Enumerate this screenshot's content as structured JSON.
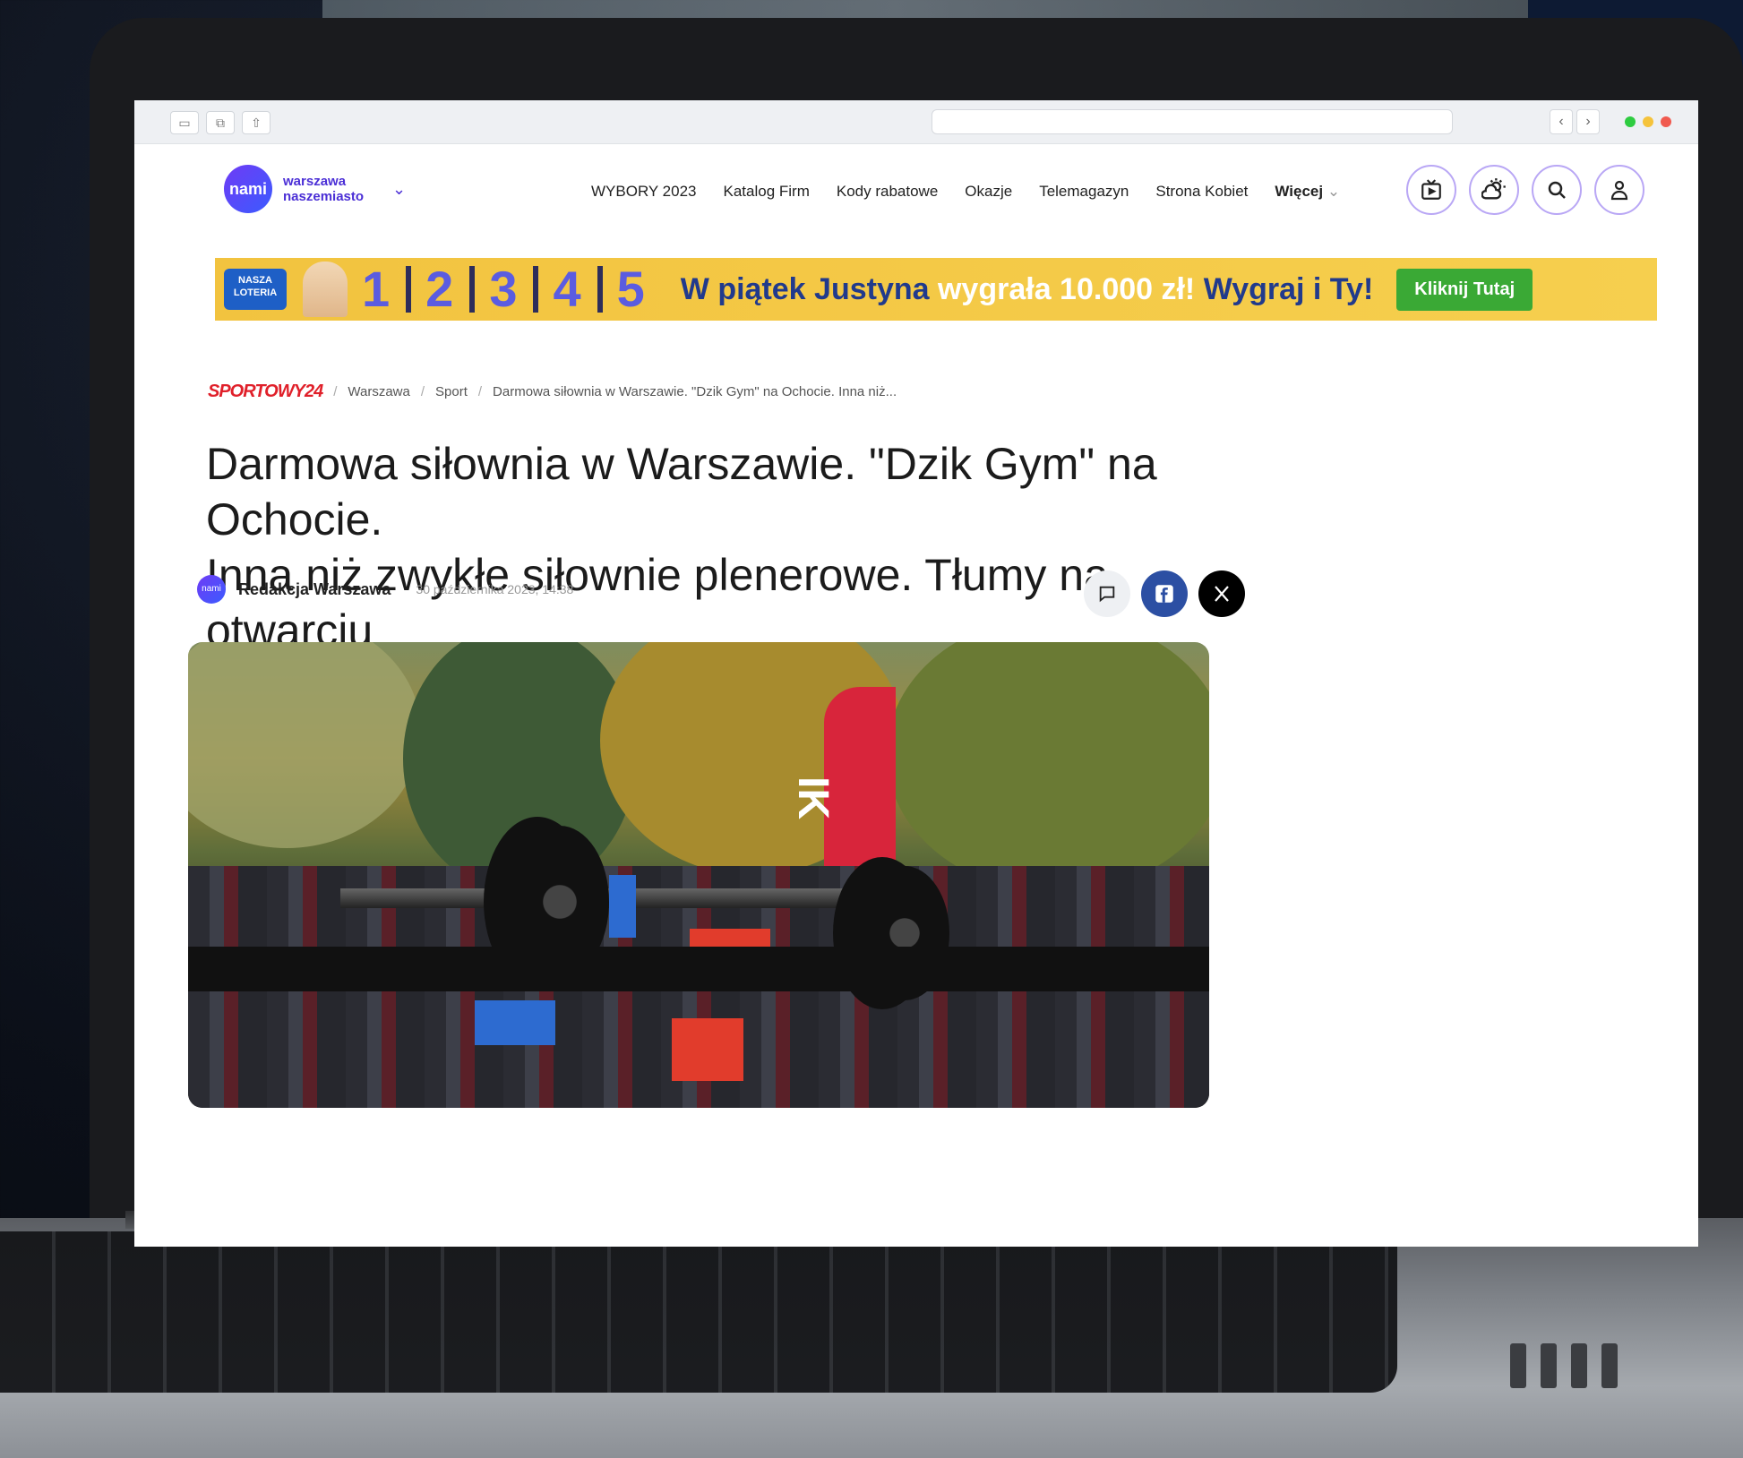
{
  "site": {
    "logo_short": "nami",
    "logo_line1": "warszawa",
    "logo_line2": "naszemiasto"
  },
  "nav": {
    "items": [
      "WYBORY 2023",
      "Katalog Firm",
      "Kody rabatowe",
      "Okazje",
      "Telemagazyn",
      "Strona Kobiet"
    ],
    "more": "Więcej"
  },
  "icons": [
    "tv-program-icon",
    "weather-icon",
    "search-icon",
    "user-icon"
  ],
  "banner": {
    "logo": "NASZA LOTERIA",
    "numbers": [
      "1",
      "2",
      "3",
      "4",
      "5"
    ],
    "msg_part1": "W piątek Justyna ",
    "msg_highlight": "wygrała 10.000 zł!",
    "msg_part2": " Wygraj i Ty!",
    "cta": "Kliknij Tutaj",
    "colors": {
      "background": "#f2c33f",
      "numbers": "#5b5ce0",
      "text": "#213a8c",
      "cta": "#3aa935"
    }
  },
  "breadcrumb": {
    "brand": "SPORTOWY24",
    "items": [
      "Warszawa",
      "Sport",
      "Darmowa siłownia w Warszawie. \"Dzik Gym\" na Ochocie. Inna niż..."
    ]
  },
  "article": {
    "title_line1": "Darmowa siłownia w Warszawie. \"Dzik Gym\" na Ochocie.",
    "title_line2": "Inna niż zwykłe siłownie plenerowe. Tłumy na otwarciu",
    "author": "Redakcja Warszawa",
    "author_avatar": "nami",
    "date": "30 października 2023, 14:38",
    "flag_text": "IK"
  },
  "share": [
    "comment-icon",
    "facebook-icon",
    "x-icon"
  ],
  "accent_color": "#4b2fd6"
}
